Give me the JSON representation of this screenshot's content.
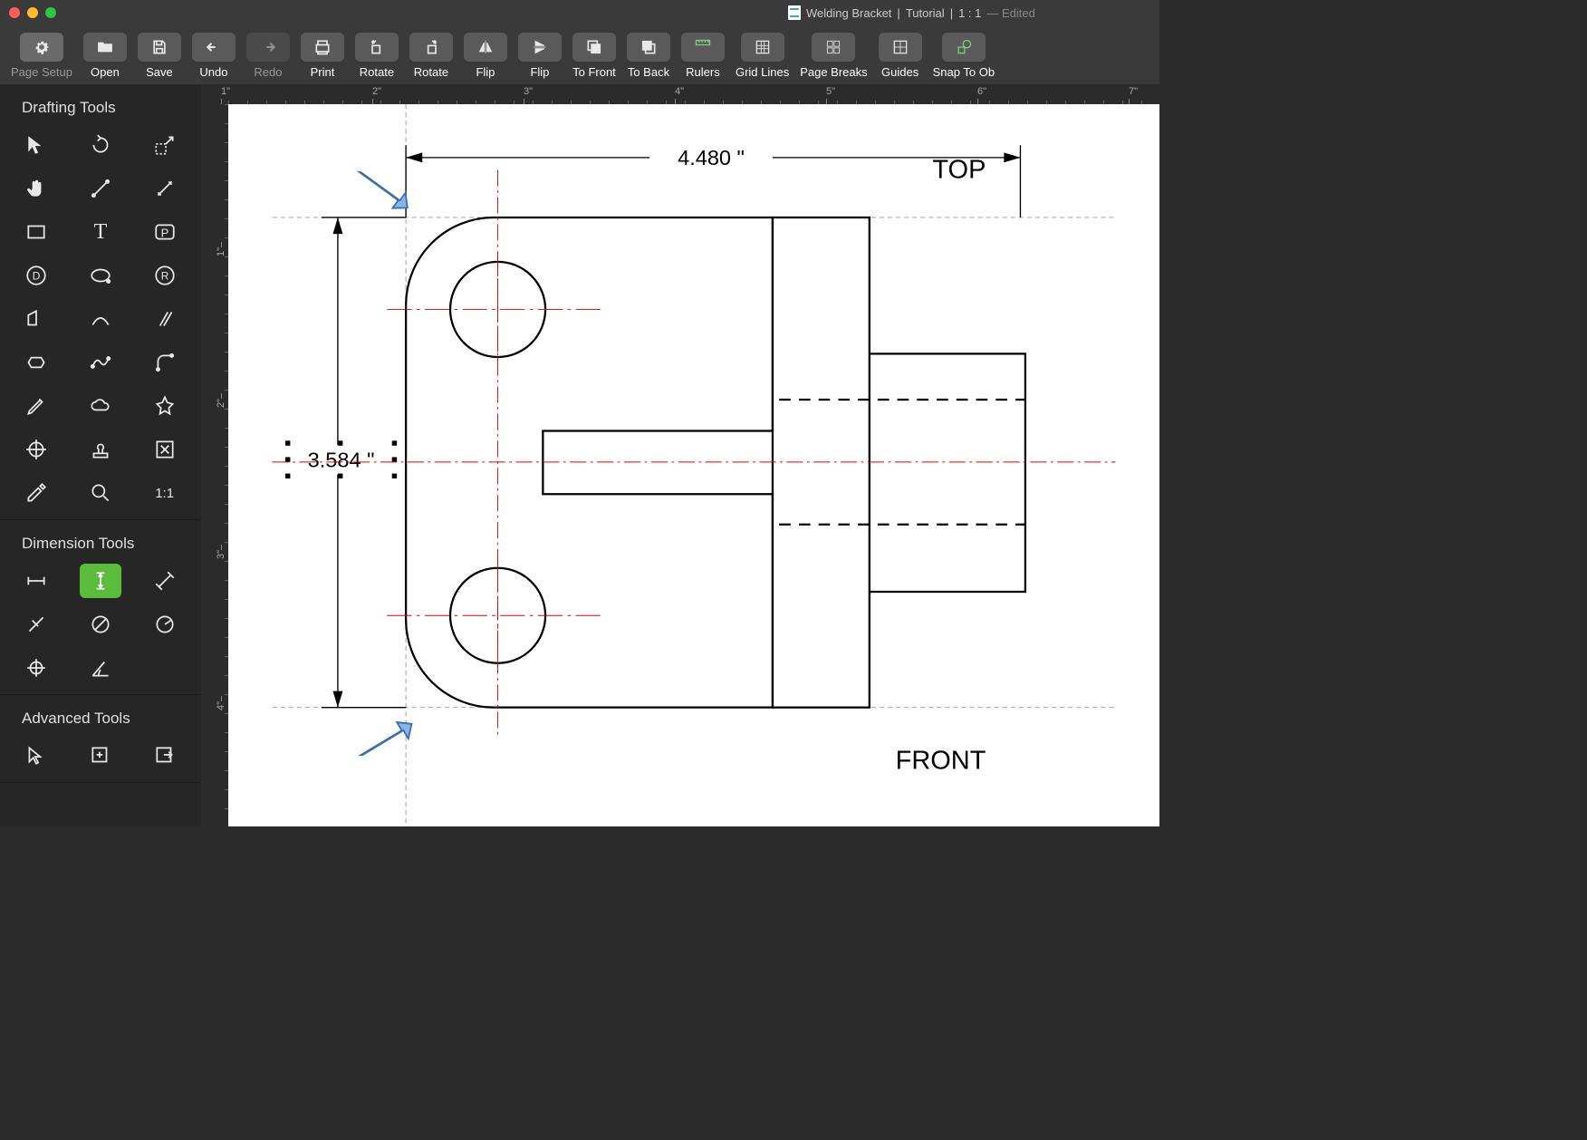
{
  "title": {
    "doc": "Welding Bracket",
    "subtitle": "Tutorial",
    "scale": "1 : 1",
    "edited": "— Edited"
  },
  "toolbar": [
    {
      "name": "page-setup",
      "label": "Page Setup",
      "icon": "gear",
      "active": true
    },
    {
      "name": "open",
      "label": "Open",
      "icon": "folder",
      "labelActive": true
    },
    {
      "name": "save",
      "label": "Save",
      "icon": "save",
      "labelActive": true
    },
    {
      "name": "undo",
      "label": "Undo",
      "icon": "undo",
      "labelActive": true
    },
    {
      "name": "redo",
      "label": "Redo",
      "icon": "redo",
      "disabled": true
    },
    {
      "name": "print",
      "label": "Print",
      "icon": "print",
      "labelActive": true
    },
    {
      "name": "rotate-ccw",
      "label": "Rotate",
      "icon": "rot-ccw",
      "labelActive": true
    },
    {
      "name": "rotate-cw",
      "label": "Rotate",
      "icon": "rot-cw",
      "labelActive": true
    },
    {
      "name": "flip-h",
      "label": "Flip",
      "icon": "flip-h",
      "labelActive": true
    },
    {
      "name": "flip-v",
      "label": "Flip",
      "icon": "flip-v",
      "labelActive": true
    },
    {
      "name": "to-front",
      "label": "To Front",
      "icon": "front",
      "labelActive": true
    },
    {
      "name": "to-back",
      "label": "To Back",
      "icon": "back",
      "labelActive": true
    },
    {
      "name": "rulers",
      "label": "Rulers",
      "icon": "rulers",
      "labelActive": true
    },
    {
      "name": "grid-lines",
      "label": "Grid Lines",
      "icon": "grid",
      "labelActive": true
    },
    {
      "name": "page-breaks",
      "label": "Page Breaks",
      "icon": "breaks",
      "labelActive": true
    },
    {
      "name": "guides",
      "label": "Guides",
      "icon": "guides",
      "labelActive": true
    },
    {
      "name": "snap",
      "label": "Snap To Ob",
      "icon": "snap",
      "labelActive": true
    }
  ],
  "panels": {
    "drafting": "Drafting Tools",
    "dimension": "Dimension Tools",
    "advanced": "Advanced Tools"
  },
  "scale_text": "1:1",
  "ruler": {
    "h": [
      "1\"",
      "2\"",
      "3\"",
      "4\"",
      "5\"",
      "6\"",
      "7\""
    ],
    "v": [
      "1\"",
      "2\"",
      "3\"",
      "4\""
    ]
  },
  "drawing": {
    "dim_top": "4.480 \"",
    "dim_left": "3.584 \"",
    "label_top": "TOP",
    "label_front": "FRONT"
  }
}
